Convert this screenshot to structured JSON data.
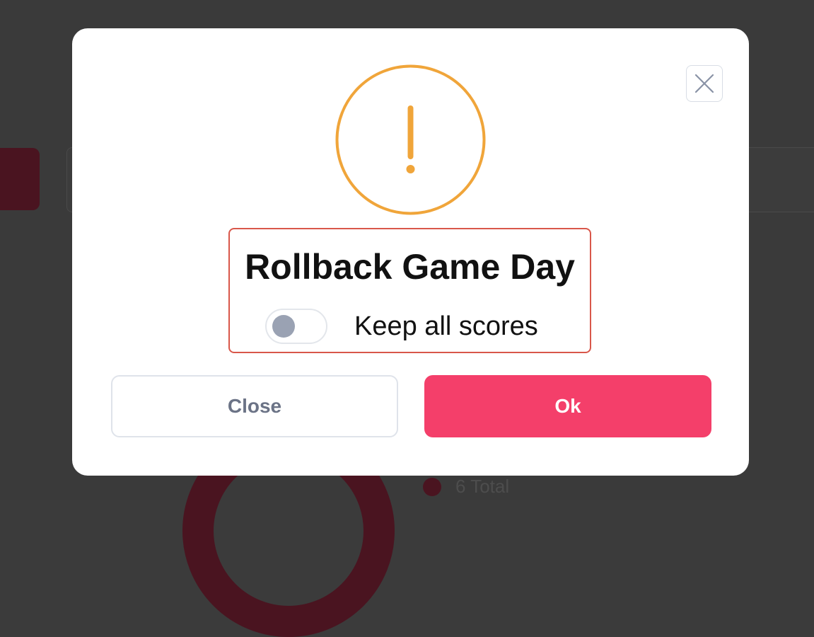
{
  "background": {
    "legend_text": "6 Total"
  },
  "modal": {
    "title": "Rollback Game Day",
    "toggle": {
      "label": "Keep all scores",
      "checked": false
    },
    "buttons": {
      "close_label": "Close",
      "ok_label": "Ok"
    },
    "icons": {
      "warning": "exclamation-circle-icon",
      "dismiss": "close-icon"
    },
    "colors": {
      "accent": "#f43f6a",
      "warning": "#f0a53a",
      "highlight_border": "#d9574a"
    }
  }
}
